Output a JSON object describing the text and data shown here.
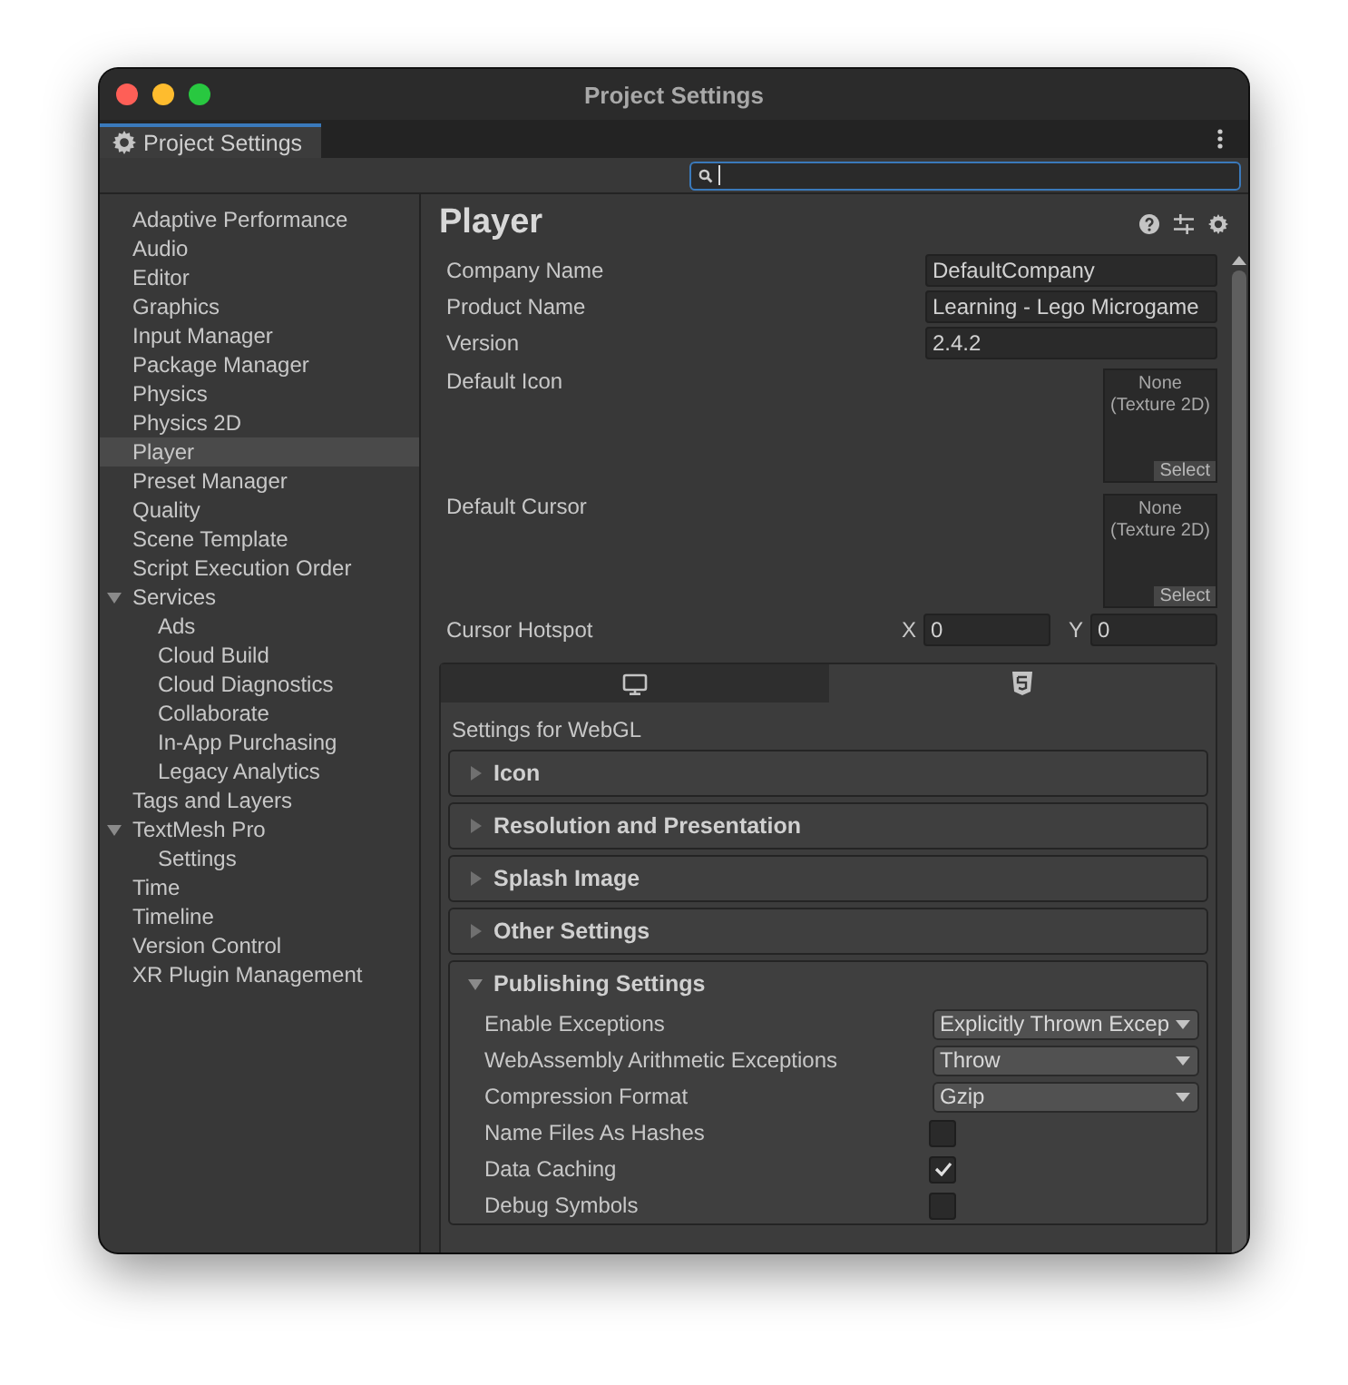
{
  "window": {
    "title": "Project Settings"
  },
  "tab": {
    "label": "Project Settings"
  },
  "sidebar": {
    "items": [
      {
        "label": "Adaptive Performance",
        "selected": false
      },
      {
        "label": "Audio",
        "selected": false
      },
      {
        "label": "Editor",
        "selected": false
      },
      {
        "label": "Graphics",
        "selected": false
      },
      {
        "label": "Input Manager",
        "selected": false
      },
      {
        "label": "Package Manager",
        "selected": false
      },
      {
        "label": "Physics",
        "selected": false
      },
      {
        "label": "Physics 2D",
        "selected": false
      },
      {
        "label": "Player",
        "selected": true
      },
      {
        "label": "Preset Manager",
        "selected": false
      },
      {
        "label": "Quality",
        "selected": false
      },
      {
        "label": "Scene Template",
        "selected": false
      },
      {
        "label": "Script Execution Order",
        "selected": false
      },
      {
        "label": "Services",
        "selected": false,
        "expanded": true,
        "children": [
          {
            "label": "Ads",
            "selected": false
          },
          {
            "label": "Cloud Build",
            "selected": false
          },
          {
            "label": "Cloud Diagnostics",
            "selected": false
          },
          {
            "label": "Collaborate",
            "selected": false
          },
          {
            "label": "In-App Purchasing",
            "selected": false
          },
          {
            "label": "Legacy Analytics",
            "selected": false
          }
        ]
      },
      {
        "label": "Tags and Layers",
        "selected": false
      },
      {
        "label": "TextMesh Pro",
        "selected": false,
        "expanded": true,
        "children": [
          {
            "label": "Settings",
            "selected": false
          }
        ]
      },
      {
        "label": "Time",
        "selected": false
      },
      {
        "label": "Timeline",
        "selected": false
      },
      {
        "label": "Version Control",
        "selected": false
      },
      {
        "label": "XR Plugin Management",
        "selected": false
      }
    ]
  },
  "panel": {
    "title": "Player",
    "fields": [
      {
        "label": "Company Name",
        "value": "DefaultCompany"
      },
      {
        "label": "Product Name",
        "value": "Learning - Lego Microgame"
      },
      {
        "label": "Version",
        "value": "2.4.2"
      }
    ],
    "object_fields": [
      {
        "label": "Default Icon",
        "value": "None",
        "type": "(Texture 2D)",
        "button": "Select"
      },
      {
        "label": "Default Cursor",
        "value": "None",
        "type": "(Texture 2D)",
        "button": "Select"
      }
    ],
    "hotspot": {
      "label": "Cursor Hotspot",
      "x_label": "X",
      "x_value": "0",
      "y_label": "Y",
      "y_value": "0"
    },
    "platform_tabs": [
      {
        "kind": "desktop",
        "selected": false
      },
      {
        "kind": "html5",
        "selected": true
      }
    ],
    "platform_heading": "Settings for WebGL",
    "sections": [
      {
        "title": "Icon",
        "expanded": false
      },
      {
        "title": "Resolution and Presentation",
        "expanded": false
      },
      {
        "title": "Splash Image",
        "expanded": false
      },
      {
        "title": "Other Settings",
        "expanded": false
      },
      {
        "title": "Publishing Settings",
        "expanded": true,
        "rows": [
          {
            "kind": "dropdown",
            "label": "Enable Exceptions",
            "value": "Explicitly Thrown Excep"
          },
          {
            "kind": "dropdown",
            "label": "WebAssembly Arithmetic Exceptions",
            "value": "Throw"
          },
          {
            "kind": "dropdown",
            "label": "Compression Format",
            "value": "Gzip"
          },
          {
            "kind": "checkbox",
            "label": "Name Files As Hashes",
            "checked": false
          },
          {
            "kind": "checkbox",
            "label": "Data Caching",
            "checked": true
          },
          {
            "kind": "checkbox",
            "label": "Debug Symbols",
            "checked": false
          }
        ]
      }
    ]
  }
}
